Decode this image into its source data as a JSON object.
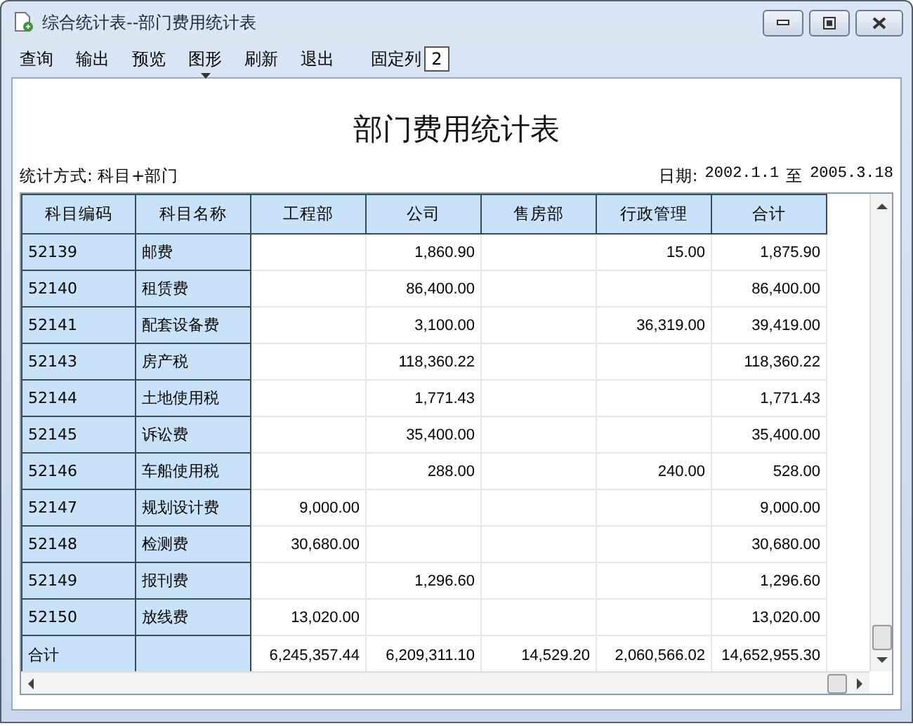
{
  "window": {
    "title": "综合统计表--部门费用统计表"
  },
  "toolbar": {
    "items": [
      {
        "label": "查询",
        "has_menu": false
      },
      {
        "label": "输出",
        "has_menu": false
      },
      {
        "label": "预览",
        "has_menu": false
      },
      {
        "label": "图形",
        "has_menu": true
      },
      {
        "label": "刷新",
        "has_menu": false
      },
      {
        "label": "退出",
        "has_menu": false
      }
    ],
    "fixed_columns": {
      "label": "固定列",
      "value": "2"
    }
  },
  "report": {
    "title": "部门费用统计表",
    "method": "统计方式: 科目+部门",
    "date_label": "日期:",
    "date_from": "2002.1.1",
    "date_sep": "至",
    "date_to": "2005.3.18"
  },
  "table": {
    "columns": [
      "科目编码",
      "科目名称",
      "工程部",
      "公司",
      "售房部",
      "行政管理",
      "合计"
    ],
    "rows": [
      {
        "kind": "item",
        "code": "52139",
        "name": "邮费",
        "company": "1,860.90",
        "administration": "15.00",
        "total": "1,875.90"
      },
      {
        "kind": "item",
        "code": "52140",
        "name": "租赁费",
        "company": "86,400.00",
        "total": "86,400.00"
      },
      {
        "kind": "item",
        "code": "52141",
        "name": "配套设备费",
        "company": "3,100.00",
        "administration": "36,319.00",
        "total": "39,419.00"
      },
      {
        "kind": "item",
        "code": "52143",
        "name": "房产税",
        "company": "118,360.22",
        "total": "118,360.22"
      },
      {
        "kind": "item",
        "code": "52144",
        "name": "土地使用税",
        "company": "1,771.43",
        "total": "1,771.43"
      },
      {
        "kind": "item",
        "code": "52145",
        "name": "诉讼费",
        "company": "35,400.00",
        "total": "35,400.00"
      },
      {
        "kind": "item",
        "code": "52146",
        "name": "车船使用税",
        "company": "288.00",
        "administration": "240.00",
        "total": "528.00"
      },
      {
        "kind": "item",
        "code": "52147",
        "name": "规划设计费",
        "engineering": "9,000.00",
        "total": "9,000.00"
      },
      {
        "kind": "item",
        "code": "52148",
        "name": "检测费",
        "engineering": "30,680.00",
        "total": "30,680.00"
      },
      {
        "kind": "item",
        "code": "52149",
        "name": "报刊费",
        "company": "1,296.60",
        "total": "1,296.60"
      },
      {
        "kind": "item",
        "code": "52150",
        "name": "放线费",
        "engineering": "13,020.00",
        "total": "13,020.00"
      },
      {
        "kind": "total",
        "code": "合计",
        "engineering": "6,245,357.44",
        "company": "6,209,311.10",
        "sales": "14,529.20",
        "administration": "2,060,566.02",
        "total": "14,652,955.30"
      }
    ]
  }
}
